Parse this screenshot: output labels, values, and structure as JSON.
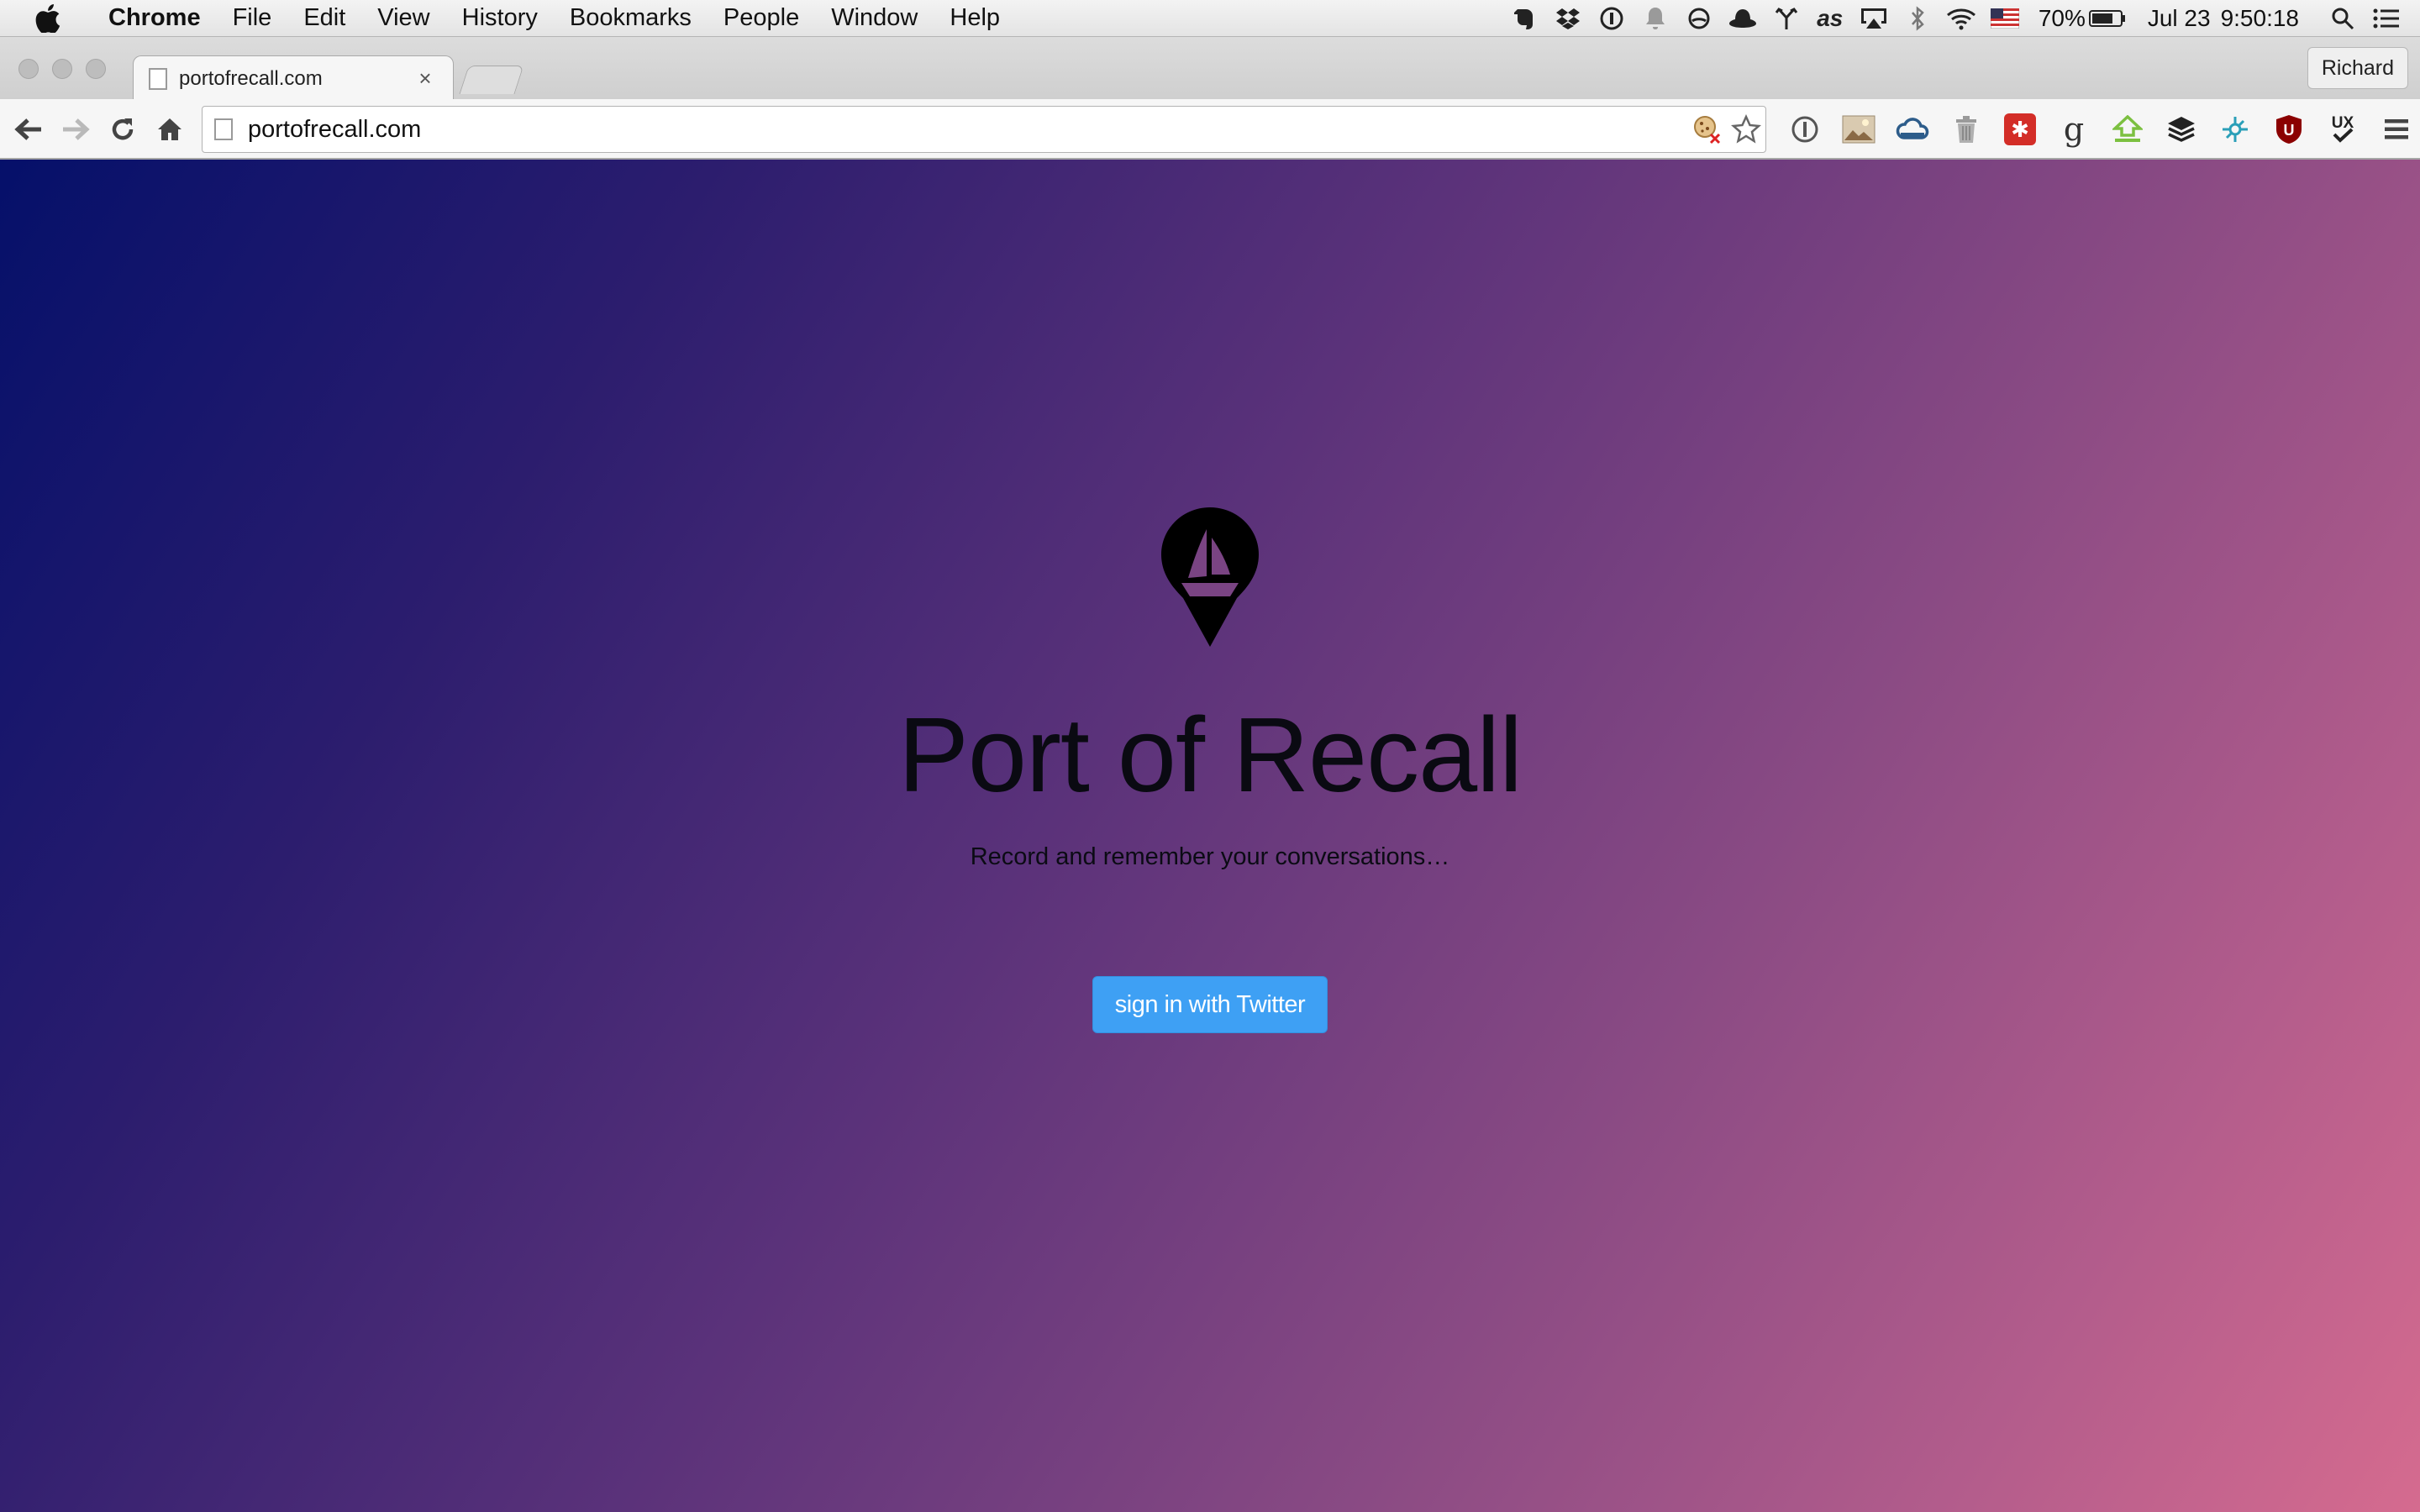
{
  "menubar": {
    "app_name": "Chrome",
    "items": [
      "File",
      "Edit",
      "View",
      "History",
      "Bookmarks",
      "People",
      "Window",
      "Help"
    ],
    "status": {
      "battery": "70%",
      "date": "Jul 23",
      "time": "9:50:18"
    }
  },
  "browser": {
    "tab_title": "portofrecall.com",
    "tab_close": "×",
    "profile_name": "Richard",
    "url": "portofrecall.com",
    "extensions": [
      "1password-icon",
      "photo-extension-icon",
      "cloud-icon",
      "trash-icon",
      "lastpass-icon",
      "goodreads-icon",
      "pushbullet-icon",
      "buffer-icon",
      "network-icon",
      "ublock-icon",
      "ux-check-icon"
    ]
  },
  "page": {
    "title": "Port of Recall",
    "tagline": "Record and remember your conversations…",
    "signin_label": "sign in with Twitter"
  },
  "colors": {
    "gradient_start": "#05106a",
    "gradient_end": "#d56b8f",
    "button": "#3ea0f4"
  }
}
